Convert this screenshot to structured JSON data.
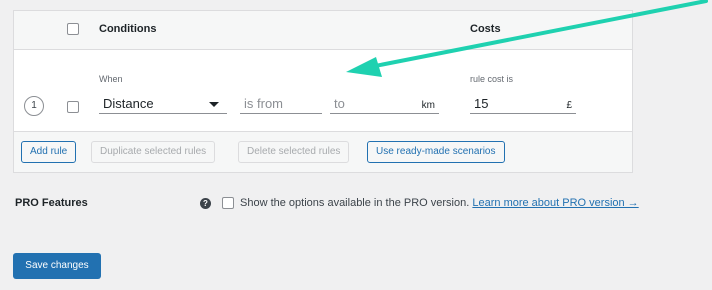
{
  "table": {
    "header": {
      "conditions": "Conditions",
      "costs": "Costs"
    },
    "row": {
      "index": "1",
      "when_label": "When",
      "condition_select": "Distance",
      "from_placeholder": "is from",
      "to_placeholder": "to",
      "unit": "km",
      "cost_label": "rule cost is",
      "cost_value": "15",
      "currency": "£"
    },
    "buttons": {
      "add_rule": "Add rule",
      "duplicate": "Duplicate selected rules",
      "delete": "Delete selected rules",
      "scenarios": "Use ready-made scenarios"
    }
  },
  "pro": {
    "label": "PRO Features",
    "help_icon": "help-icon",
    "text": "Show the options available in the PRO version.",
    "link": "Learn more about PRO version →"
  },
  "save_label": "Save changes",
  "colors": {
    "accent": "#2271b1",
    "arrow": "#1fd1b0"
  }
}
